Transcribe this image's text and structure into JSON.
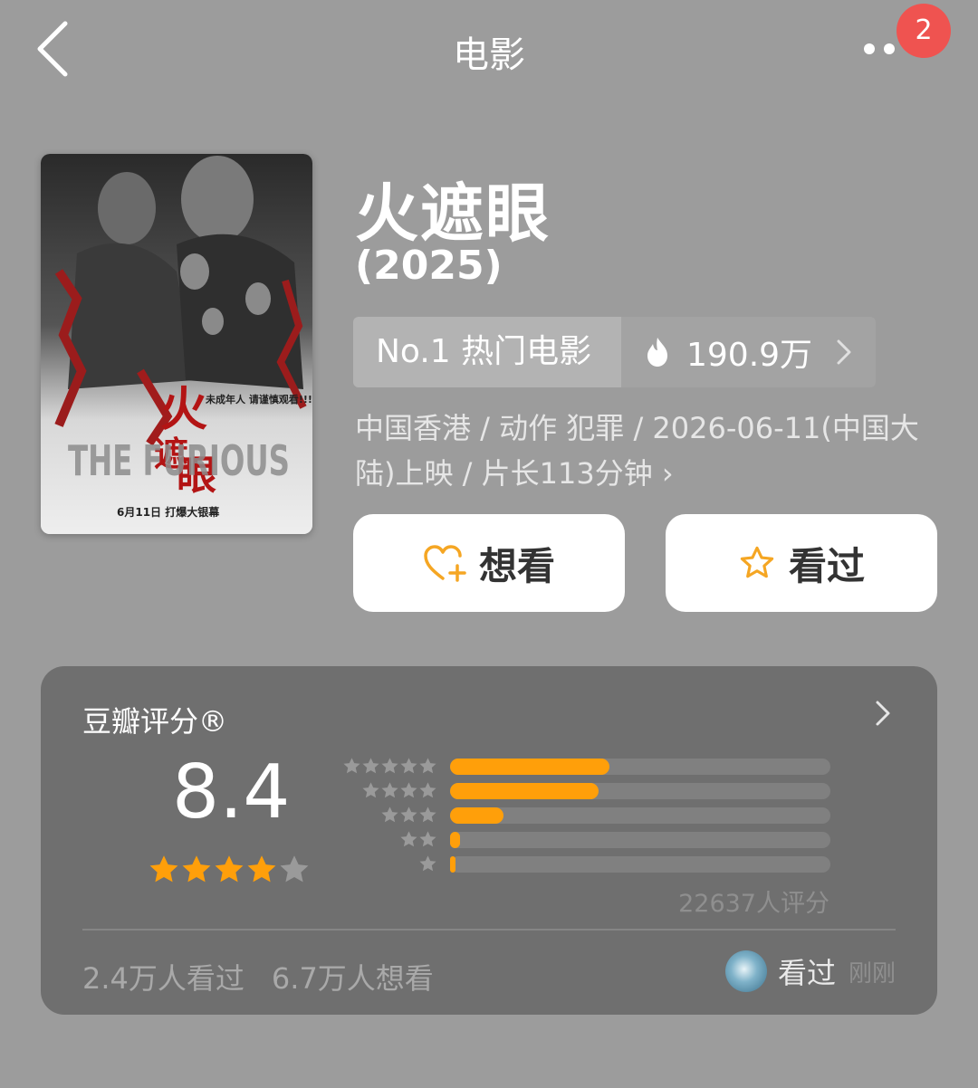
{
  "header": {
    "title": "电影",
    "badge_count": "2"
  },
  "movie": {
    "title": "火遮眼",
    "year": "(2025)",
    "rank_label": "No.1 热门电影",
    "heat": "190.9万",
    "meta": "中国香港 / 动作 犯罪 / 2026-06-11(中国大陆)上映 / 片长113分钟",
    "meta_chevron": "›",
    "poster_texts": {
      "tagline": "未成年人 请谨慎观看!!!",
      "english_title": "THE FURIOUS",
      "release": "6月11日  打爆大银幕"
    }
  },
  "actions": {
    "want_label": "想看",
    "seen_label": "看过"
  },
  "rating": {
    "title": "豆瓣评分®",
    "score": "8.4",
    "score_stars_filled": 4,
    "distribution": [
      {
        "stars": 5,
        "value": 0.42
      },
      {
        "stars": 4,
        "value": 0.39
      },
      {
        "stars": 3,
        "value": 0.14
      },
      {
        "stars": 2,
        "value": 0.026
      },
      {
        "stars": 1,
        "value": 0.008
      }
    ],
    "count_text": "22637人评分",
    "seen_count": "2.4万人看过",
    "want_count": "6.7万人想看",
    "my_status": "看过",
    "my_status_time": "刚刚"
  },
  "colors": {
    "accent": "#ff9f0a",
    "badge": "#ef5350",
    "background": "#9c9c9c",
    "card": "#6f6f6f"
  }
}
